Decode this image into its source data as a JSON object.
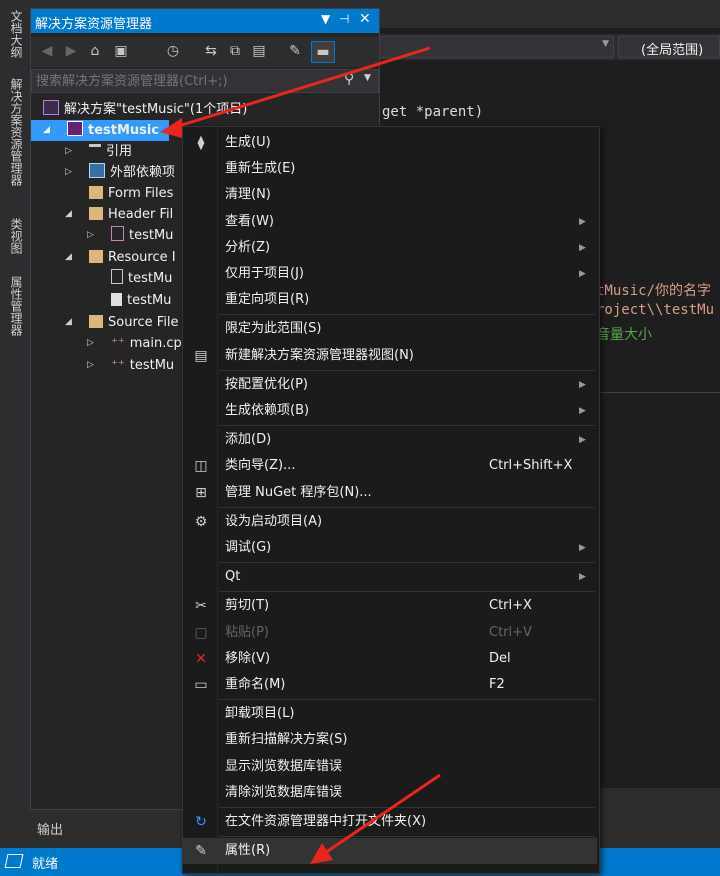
{
  "vertical_tabs": [
    "文档大纲",
    "解决方案资源管理器",
    "类视图",
    "属性管理器"
  ],
  "solution_explorer": {
    "title": "解决方案资源管理器",
    "search_placeholder": "搜索解决方案资源管理器(Ctrl+;)",
    "tree": [
      {
        "label": "解决方案\"testMusic\"(1个项目)",
        "icon": "solution-icon"
      },
      {
        "label": "testMusic",
        "icon": "project-icon",
        "selected": true
      },
      {
        "label": "引用",
        "icon": "references-icon"
      },
      {
        "label": "外部依赖项",
        "icon": "external-deps-icon"
      },
      {
        "label": "Form Files",
        "icon": "folder-icon"
      },
      {
        "label": "Header Fil",
        "icon": "folder-icon"
      },
      {
        "label": "testMu",
        "icon": "header-file-icon"
      },
      {
        "label": "Resource I",
        "icon": "folder-icon"
      },
      {
        "label": "testMu",
        "icon": "file-icon"
      },
      {
        "label": "testMu",
        "icon": "resource-file-icon"
      },
      {
        "label": "Source File",
        "icon": "folder-icon"
      },
      {
        "label": "main.cp",
        "icon": "cpp-file-icon"
      },
      {
        "label": "testMu",
        "icon": "cpp-file-icon"
      }
    ]
  },
  "editor": {
    "scope_dropdown": "(全局范围)",
    "code_fragments": {
      "line1": "get *parent)",
      "line2": "tMusic/你的名字",
      "line3": "roject\\\\testMu",
      "line4": "音量大小"
    }
  },
  "output_tab": "输出",
  "status": "就绪",
  "context_menu": {
    "items": [
      {
        "icon": "build-icon",
        "label": "生成(U)",
        "shortcut": "",
        "submenu": false
      },
      {
        "icon": "",
        "label": "重新生成(E)",
        "shortcut": "",
        "submenu": false
      },
      {
        "icon": "",
        "label": "清理(N)",
        "shortcut": "",
        "submenu": false
      },
      {
        "icon": "",
        "label": "查看(W)",
        "shortcut": "",
        "submenu": true
      },
      {
        "icon": "",
        "label": "分析(Z)",
        "shortcut": "",
        "submenu": true
      },
      {
        "icon": "",
        "label": "仅用于项目(J)",
        "shortcut": "",
        "submenu": true
      },
      {
        "icon": "",
        "label": "重定向项目(R)",
        "shortcut": "",
        "submenu": false
      },
      {
        "icon": "",
        "label": "限定为此范围(S)",
        "shortcut": "",
        "submenu": false
      },
      {
        "icon": "new-view-icon",
        "label": "新建解决方案资源管理器视图(N)",
        "shortcut": "",
        "submenu": false
      },
      {
        "icon": "",
        "label": "按配置优化(P)",
        "shortcut": "",
        "submenu": true
      },
      {
        "icon": "",
        "label": "生成依赖项(B)",
        "shortcut": "",
        "submenu": true
      },
      {
        "icon": "",
        "label": "添加(D)",
        "shortcut": "",
        "submenu": true
      },
      {
        "icon": "class-wizard-icon",
        "label": "类向导(Z)...",
        "shortcut": "Ctrl+Shift+X",
        "submenu": false
      },
      {
        "icon": "nuget-icon",
        "label": "管理 NuGet 程序包(N)...",
        "shortcut": "",
        "submenu": false
      },
      {
        "icon": "gear-icon",
        "label": "设为启动项目(A)",
        "shortcut": "",
        "submenu": false
      },
      {
        "icon": "",
        "label": "调试(G)",
        "shortcut": "",
        "submenu": true
      },
      {
        "icon": "",
        "label": "Qt",
        "shortcut": "",
        "submenu": true
      },
      {
        "icon": "scissors-icon",
        "label": "剪切(T)",
        "shortcut": "Ctrl+X",
        "submenu": false
      },
      {
        "icon": "paste-icon",
        "label": "粘贴(P)",
        "shortcut": "Ctrl+V",
        "submenu": false,
        "disabled": true
      },
      {
        "icon": "remove-icon",
        "label": "移除(V)",
        "shortcut": "Del",
        "submenu": false
      },
      {
        "icon": "rename-icon",
        "label": "重命名(M)",
        "shortcut": "F2",
        "submenu": false
      },
      {
        "icon": "",
        "label": "卸载项目(L)",
        "shortcut": "",
        "submenu": false
      },
      {
        "icon": "",
        "label": "重新扫描解决方案(S)",
        "shortcut": "",
        "submenu": false
      },
      {
        "icon": "",
        "label": "显示浏览数据库错误",
        "shortcut": "",
        "submenu": false
      },
      {
        "icon": "",
        "label": "清除浏览数据库错误",
        "shortcut": "",
        "submenu": false
      },
      {
        "icon": "open-folder-icon",
        "label": "在文件资源管理器中打开文件夹(X)",
        "shortcut": "",
        "submenu": false
      },
      {
        "icon": "wrench-icon",
        "label": "属性(R)",
        "shortcut": "",
        "submenu": false,
        "highlighted": true
      }
    ]
  },
  "colors": {
    "accent": "#007acc",
    "arrow": "#e8261e"
  }
}
